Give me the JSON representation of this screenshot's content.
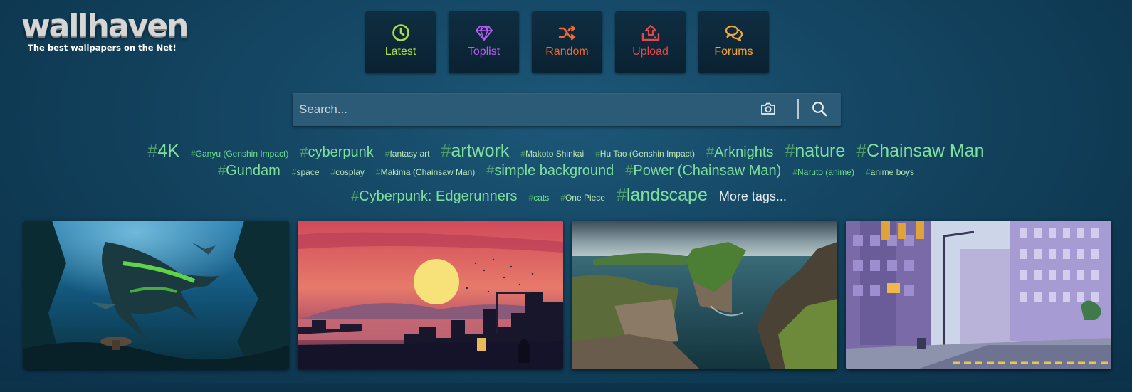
{
  "brand": {
    "name": "wallhaven",
    "tagline": "The best wallpapers on the Net!"
  },
  "nav": [
    {
      "label": "Latest",
      "icon": "clock-icon",
      "color": "#a9e23d"
    },
    {
      "label": "Toplist",
      "icon": "diamond-icon",
      "color": "#b45cf0"
    },
    {
      "label": "Random",
      "icon": "shuffle-icon",
      "color": "#f06a32"
    },
    {
      "label": "Upload",
      "icon": "upload-icon",
      "color": "#e8474a"
    },
    {
      "label": "Forums",
      "icon": "chat-icon",
      "color": "#f5a83a"
    }
  ],
  "search": {
    "placeholder": "Search...",
    "camera_icon": "camera-icon",
    "search_icon": "search-icon"
  },
  "tags": {
    "row1": [
      "4K",
      "Ganyu (Genshin Impact)",
      "cyberpunk",
      "fantasy art",
      "artwork",
      "Makoto Shinkai",
      "Hu Tao (Genshin Impact)",
      "Arknights",
      "nature",
      "Chainsaw Man"
    ],
    "row2": [
      "Gundam",
      "space",
      "cosplay",
      "Makima (Chainsaw Man)",
      "simple background",
      "Power (Chainsaw Man)",
      "Naruto (anime)",
      "anime boys"
    ],
    "row3": [
      "Cyberpunk: Edgerunners",
      "cats",
      "One Piece",
      "landscape"
    ],
    "more": "More tags..."
  },
  "thumbnails": [
    "shark-wallpaper",
    "sunset-city-wallpaper",
    "cliffs-wallpaper",
    "street-wallpaper"
  ]
}
